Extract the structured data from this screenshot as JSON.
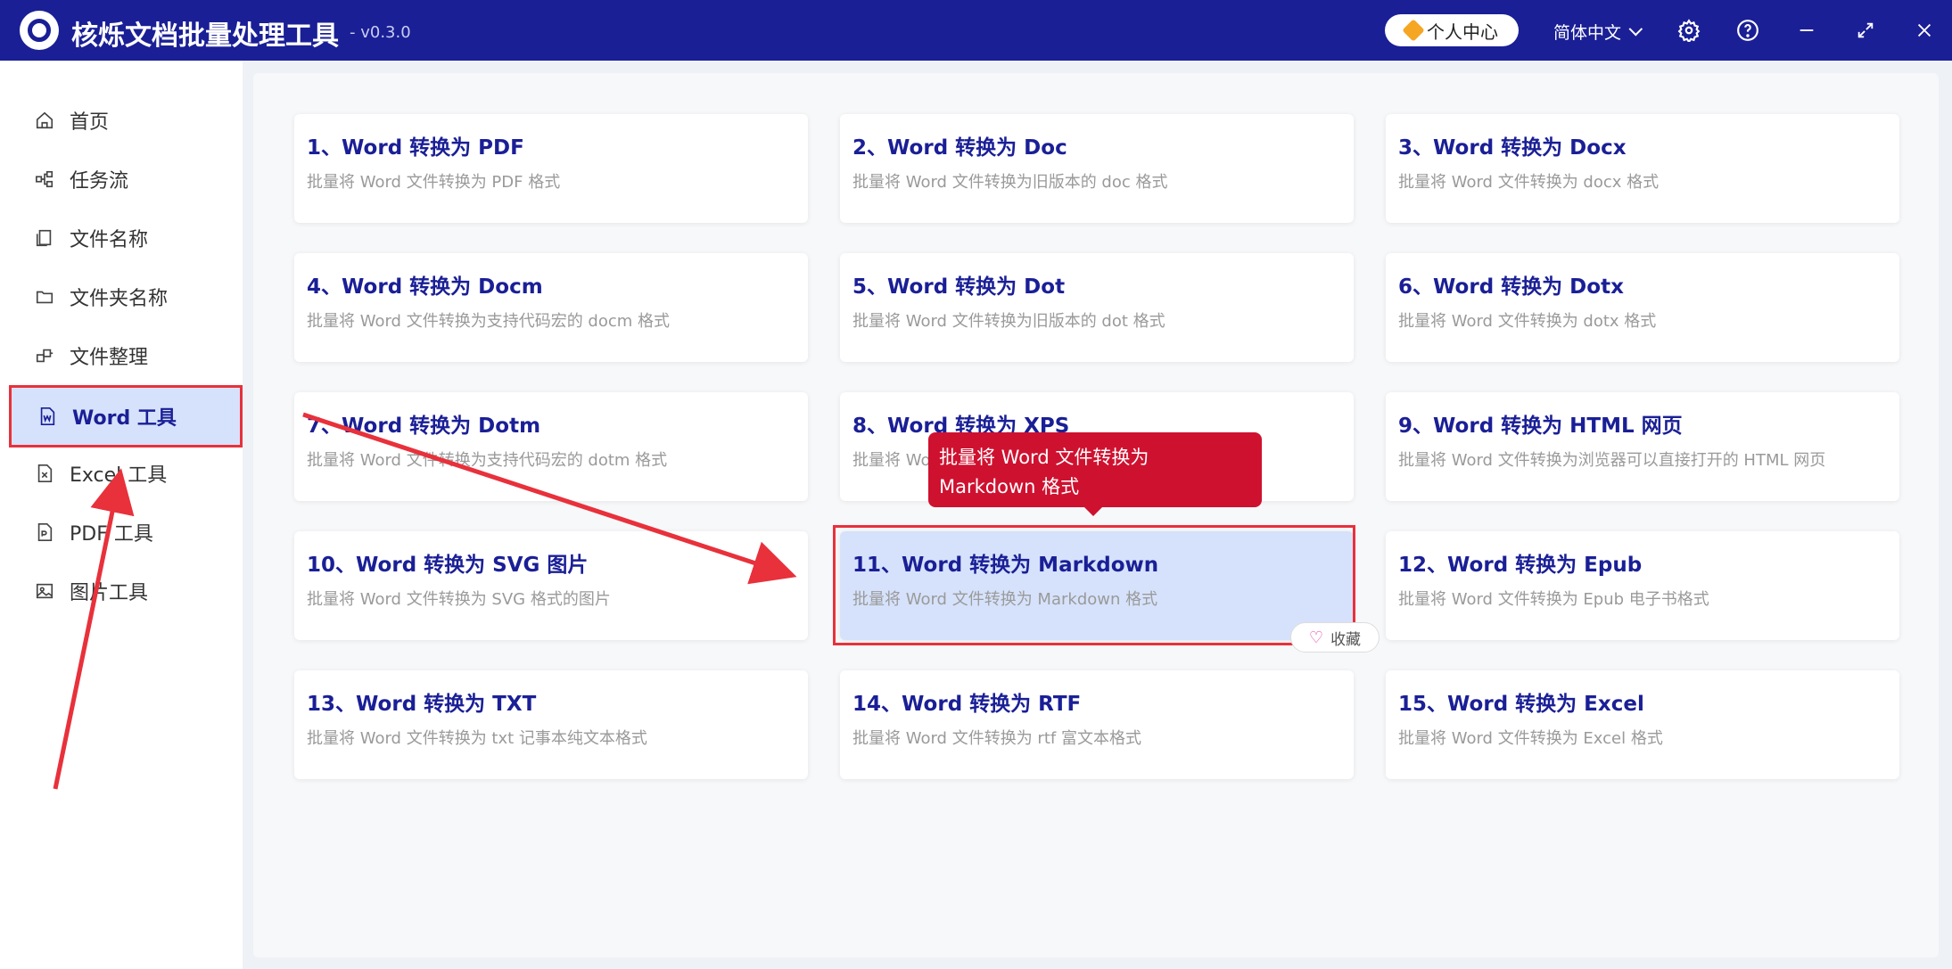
{
  "app": {
    "title": "核烁文档批量处理工具",
    "version": "- v0.3.0",
    "user_center": "个人中心",
    "language": "简体中文"
  },
  "sidebar": {
    "items": [
      {
        "label": "首页",
        "icon": "home-icon"
      },
      {
        "label": "任务流",
        "icon": "workflow-icon"
      },
      {
        "label": "文件名称",
        "icon": "file-name-icon"
      },
      {
        "label": "文件夹名称",
        "icon": "folder-icon"
      },
      {
        "label": "文件整理",
        "icon": "organize-icon"
      },
      {
        "label": "Word 工具",
        "icon": "word-icon",
        "active": true
      },
      {
        "label": "Excel 工具",
        "icon": "excel-icon"
      },
      {
        "label": "PDF 工具",
        "icon": "pdf-icon"
      },
      {
        "label": "图片工具",
        "icon": "image-icon"
      }
    ]
  },
  "cards": [
    {
      "title": "1、Word 转换为 PDF",
      "desc": "批量将 Word 文件转换为 PDF 格式"
    },
    {
      "title": "2、Word 转换为 Doc",
      "desc": "批量将 Word 文件转换为旧版本的 doc 格式"
    },
    {
      "title": "3、Word 转换为 Docx",
      "desc": "批量将 Word 文件转换为 docx 格式"
    },
    {
      "title": "4、Word 转换为 Docm",
      "desc": "批量将 Word 文件转换为支持代码宏的 docm 格式"
    },
    {
      "title": "5、Word 转换为 Dot",
      "desc": "批量将 Word 文件转换为旧版本的 dot 格式"
    },
    {
      "title": "6、Word 转换为 Dotx",
      "desc": "批量将 Word 文件转换为 dotx 格式"
    },
    {
      "title": "7、Word 转换为 Dotm",
      "desc": "批量将 Word 文件转换为支持代码宏的 dotm 格式"
    },
    {
      "title": "8、Word 转换为 XPS",
      "desc": "批量将 Word 文件转换为 XPS 格式"
    },
    {
      "title": "9、Word 转换为 HTML 网页",
      "desc": "批量将 Word 文件转换为浏览器可以直接打开的 HTML 网页"
    },
    {
      "title": "10、Word 转换为 SVG 图片",
      "desc": "批量将 Word 文件转换为 SVG 格式的图片"
    },
    {
      "title": "11、Word 转换为 Markdown",
      "desc": "批量将 Word 文件转换为 Markdown 格式",
      "highlighted": true
    },
    {
      "title": "12、Word 转换为 Epub",
      "desc": "批量将 Word 文件转换为 Epub 电子书格式"
    },
    {
      "title": "13、Word 转换为 TXT",
      "desc": "批量将 Word 文件转换为 txt 记事本纯文本格式"
    },
    {
      "title": "14、Word 转换为 RTF",
      "desc": "批量将 Word 文件转换为 rtf 富文本格式"
    },
    {
      "title": "15、Word 转换为 Excel",
      "desc": "批量将 Word 文件转换为 Excel 格式"
    }
  ],
  "tooltip": {
    "text": "批量将 Word 文件转换为 Markdown 格式"
  },
  "favorite": {
    "label": "收藏"
  },
  "colors": {
    "titlebar": "#1a1f96",
    "accent": "#1a1f96",
    "highlight": "#d6e2fb",
    "annotation_red": "#e8313b",
    "tooltip": "#cf1130"
  }
}
